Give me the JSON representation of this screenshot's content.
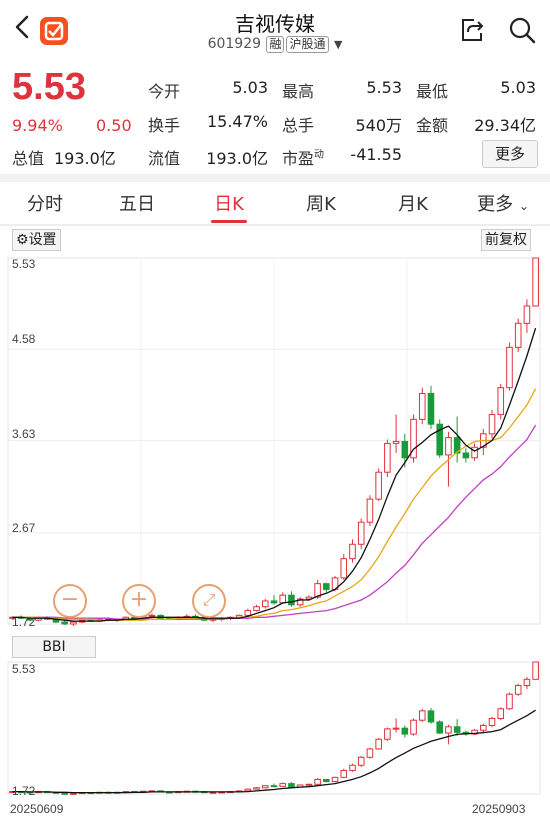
{
  "header": {
    "title": "吉视传媒",
    "code": "601929",
    "tags": [
      "融",
      "沪股通"
    ]
  },
  "quote": {
    "price": "5.53",
    "change_pct": "9.94%",
    "change": "0.50",
    "rows": [
      [
        {
          "label": "今开",
          "value": "5.03"
        },
        {
          "label": "最高",
          "value": "5.53",
          "red": true
        },
        {
          "label": "最低",
          "value": "5.03"
        }
      ],
      [
        {
          "label": "换手",
          "value": "15.47%"
        },
        {
          "label": "总手",
          "value": "540万"
        },
        {
          "label": "金额",
          "value": "29.34亿"
        }
      ],
      [
        {
          "label": "总值",
          "value": "193.0亿"
        },
        {
          "label": "流值",
          "value": "193.0亿"
        },
        {
          "label": "市盈动",
          "value": "-41.55"
        }
      ]
    ],
    "more_label": "更多"
  },
  "tabs": [
    "分时",
    "五日",
    "日K",
    "周K",
    "月K",
    "更多"
  ],
  "active_tab": 2,
  "chart": {
    "settings_label": "设置",
    "adjust_label": "前复权",
    "y_labels": [
      "5.53",
      "4.58",
      "3.63",
      "2.67",
      "1.72"
    ],
    "bbi_label": "BBI",
    "bbi_y_labels": [
      "5.53",
      "1.72"
    ],
    "start_date": "20250609",
    "end_date": "20250903",
    "zoom_out": "−",
    "zoom_in": "+",
    "colors": {
      "up": "#e0323c",
      "down": "#1a9b3a",
      "ma5": "#111111",
      "ma10": "#e6a817",
      "ma20": "#c23fc8"
    }
  },
  "chart_data": {
    "type": "candlestick",
    "ylim": [
      1.72,
      5.53
    ],
    "ohlc": [
      [
        1.78,
        1.8,
        1.76,
        1.79
      ],
      [
        1.79,
        1.81,
        1.77,
        1.78
      ],
      [
        1.78,
        1.79,
        1.75,
        1.76
      ],
      [
        1.76,
        1.8,
        1.75,
        1.79
      ],
      [
        1.79,
        1.8,
        1.76,
        1.77
      ],
      [
        1.77,
        1.78,
        1.73,
        1.74
      ],
      [
        1.74,
        1.76,
        1.71,
        1.72
      ],
      [
        1.72,
        1.75,
        1.7,
        1.74
      ],
      [
        1.74,
        1.77,
        1.73,
        1.76
      ],
      [
        1.76,
        1.78,
        1.74,
        1.75
      ],
      [
        1.75,
        1.78,
        1.74,
        1.77
      ],
      [
        1.77,
        1.79,
        1.75,
        1.76
      ],
      [
        1.76,
        1.78,
        1.74,
        1.77
      ],
      [
        1.77,
        1.8,
        1.76,
        1.79
      ],
      [
        1.79,
        1.81,
        1.77,
        1.78
      ],
      [
        1.78,
        1.8,
        1.76,
        1.8
      ],
      [
        1.8,
        1.83,
        1.78,
        1.81
      ],
      [
        1.81,
        1.82,
        1.77,
        1.78
      ],
      [
        1.78,
        1.79,
        1.76,
        1.77
      ],
      [
        1.77,
        1.8,
        1.76,
        1.79
      ],
      [
        1.79,
        1.82,
        1.78,
        1.8
      ],
      [
        1.8,
        1.82,
        1.78,
        1.79
      ],
      [
        1.79,
        1.8,
        1.75,
        1.76
      ],
      [
        1.76,
        1.78,
        1.74,
        1.77
      ],
      [
        1.77,
        1.79,
        1.75,
        1.78
      ],
      [
        1.78,
        1.8,
        1.76,
        1.79
      ],
      [
        1.79,
        1.82,
        1.78,
        1.81
      ],
      [
        1.81,
        1.88,
        1.8,
        1.86
      ],
      [
        1.86,
        1.92,
        1.85,
        1.9
      ],
      [
        1.9,
        1.98,
        1.88,
        1.96
      ],
      [
        1.96,
        2.02,
        1.92,
        1.94
      ],
      [
        1.94,
        2.05,
        1.93,
        2.02
      ],
      [
        2.02,
        2.06,
        1.9,
        1.92
      ],
      [
        1.92,
        2.0,
        1.9,
        1.98
      ],
      [
        1.98,
        2.02,
        1.96,
        2.0
      ],
      [
        2.0,
        2.18,
        1.98,
        2.14
      ],
      [
        2.14,
        2.15,
        2.05,
        2.08
      ],
      [
        2.08,
        2.22,
        2.06,
        2.2
      ],
      [
        2.2,
        2.45,
        2.18,
        2.4
      ],
      [
        2.4,
        2.6,
        2.36,
        2.55
      ],
      [
        2.55,
        2.82,
        2.5,
        2.78
      ],
      [
        2.78,
        3.06,
        2.74,
        3.02
      ],
      [
        3.02,
        3.34,
        3.0,
        3.3
      ],
      [
        3.3,
        3.64,
        3.25,
        3.6
      ],
      [
        3.6,
        3.9,
        3.5,
        3.62
      ],
      [
        3.62,
        3.7,
        3.35,
        3.45
      ],
      [
        3.45,
        3.9,
        3.4,
        3.85
      ],
      [
        3.85,
        4.18,
        3.8,
        4.12
      ],
      [
        4.12,
        4.2,
        3.75,
        3.8
      ],
      [
        3.8,
        3.85,
        3.45,
        3.48
      ],
      [
        3.48,
        3.72,
        3.15,
        3.66
      ],
      [
        3.66,
        3.88,
        3.4,
        3.5
      ],
      [
        3.5,
        3.55,
        3.4,
        3.45
      ],
      [
        3.45,
        3.6,
        3.42,
        3.56
      ],
      [
        3.56,
        3.75,
        3.48,
        3.7
      ],
      [
        3.7,
        3.95,
        3.65,
        3.9
      ],
      [
        3.9,
        4.22,
        3.85,
        4.18
      ],
      [
        4.18,
        4.65,
        4.15,
        4.6
      ],
      [
        4.6,
        4.9,
        4.55,
        4.85
      ],
      [
        4.85,
        5.1,
        4.75,
        5.03
      ],
      [
        5.03,
        5.53,
        5.03,
        5.53
      ]
    ],
    "ma5": [
      1.79,
      1.79,
      1.78,
      1.78,
      1.78,
      1.77,
      1.76,
      1.75,
      1.75,
      1.75,
      1.75,
      1.76,
      1.76,
      1.77,
      1.77,
      1.78,
      1.79,
      1.79,
      1.79,
      1.79,
      1.79,
      1.79,
      1.78,
      1.78,
      1.78,
      1.78,
      1.78,
      1.8,
      1.83,
      1.86,
      1.89,
      1.94,
      1.95,
      1.97,
      1.97,
      2.01,
      2.04,
      2.08,
      2.16,
      2.27,
      2.41,
      2.6,
      2.81,
      3.05,
      3.27,
      3.4,
      3.54,
      3.61,
      3.69,
      3.74,
      3.78,
      3.69,
      3.58,
      3.52,
      3.57,
      3.63,
      3.76,
      4.0,
      4.25,
      4.51,
      4.8
    ],
    "ma10": [
      1.79,
      1.79,
      1.79,
      1.79,
      1.78,
      1.78,
      1.77,
      1.77,
      1.77,
      1.77,
      1.76,
      1.76,
      1.76,
      1.76,
      1.76,
      1.76,
      1.77,
      1.77,
      1.77,
      1.78,
      1.78,
      1.78,
      1.78,
      1.78,
      1.78,
      1.78,
      1.79,
      1.79,
      1.8,
      1.82,
      1.83,
      1.86,
      1.87,
      1.89,
      1.91,
      1.94,
      1.96,
      2.01,
      2.06,
      2.11,
      2.18,
      2.29,
      2.42,
      2.58,
      2.73,
      2.87,
      3.02,
      3.14,
      3.26,
      3.35,
      3.43,
      3.51,
      3.57,
      3.62,
      3.63,
      3.63,
      3.66,
      3.76,
      3.88,
      4.0,
      4.17
    ],
    "ma20": [
      1.79,
      1.79,
      1.79,
      1.79,
      1.79,
      1.79,
      1.78,
      1.78,
      1.78,
      1.78,
      1.78,
      1.78,
      1.77,
      1.77,
      1.77,
      1.77,
      1.77,
      1.77,
      1.77,
      1.77,
      1.77,
      1.77,
      1.77,
      1.77,
      1.77,
      1.78,
      1.78,
      1.78,
      1.79,
      1.79,
      1.8,
      1.81,
      1.82,
      1.83,
      1.84,
      1.85,
      1.86,
      1.88,
      1.91,
      1.94,
      1.97,
      2.02,
      2.09,
      2.16,
      2.25,
      2.33,
      2.44,
      2.56,
      2.65,
      2.74,
      2.83,
      2.94,
      3.04,
      3.13,
      3.22,
      3.28,
      3.36,
      3.46,
      3.55,
      3.64,
      3.79
    ],
    "bbi": [
      1.79,
      1.79,
      1.78,
      1.78,
      1.78,
      1.77,
      1.77,
      1.76,
      1.76,
      1.76,
      1.76,
      1.76,
      1.76,
      1.76,
      1.77,
      1.77,
      1.78,
      1.78,
      1.78,
      1.78,
      1.78,
      1.78,
      1.78,
      1.78,
      1.78,
      1.78,
      1.78,
      1.79,
      1.81,
      1.83,
      1.85,
      1.88,
      1.9,
      1.92,
      1.93,
      1.96,
      1.99,
      2.02,
      2.08,
      2.14,
      2.22,
      2.33,
      2.46,
      2.62,
      2.77,
      2.9,
      3.04,
      3.14,
      3.24,
      3.31,
      3.38,
      3.44,
      3.46,
      3.47,
      3.49,
      3.52,
      3.58,
      3.72,
      3.85,
      3.98,
      4.14
    ]
  }
}
